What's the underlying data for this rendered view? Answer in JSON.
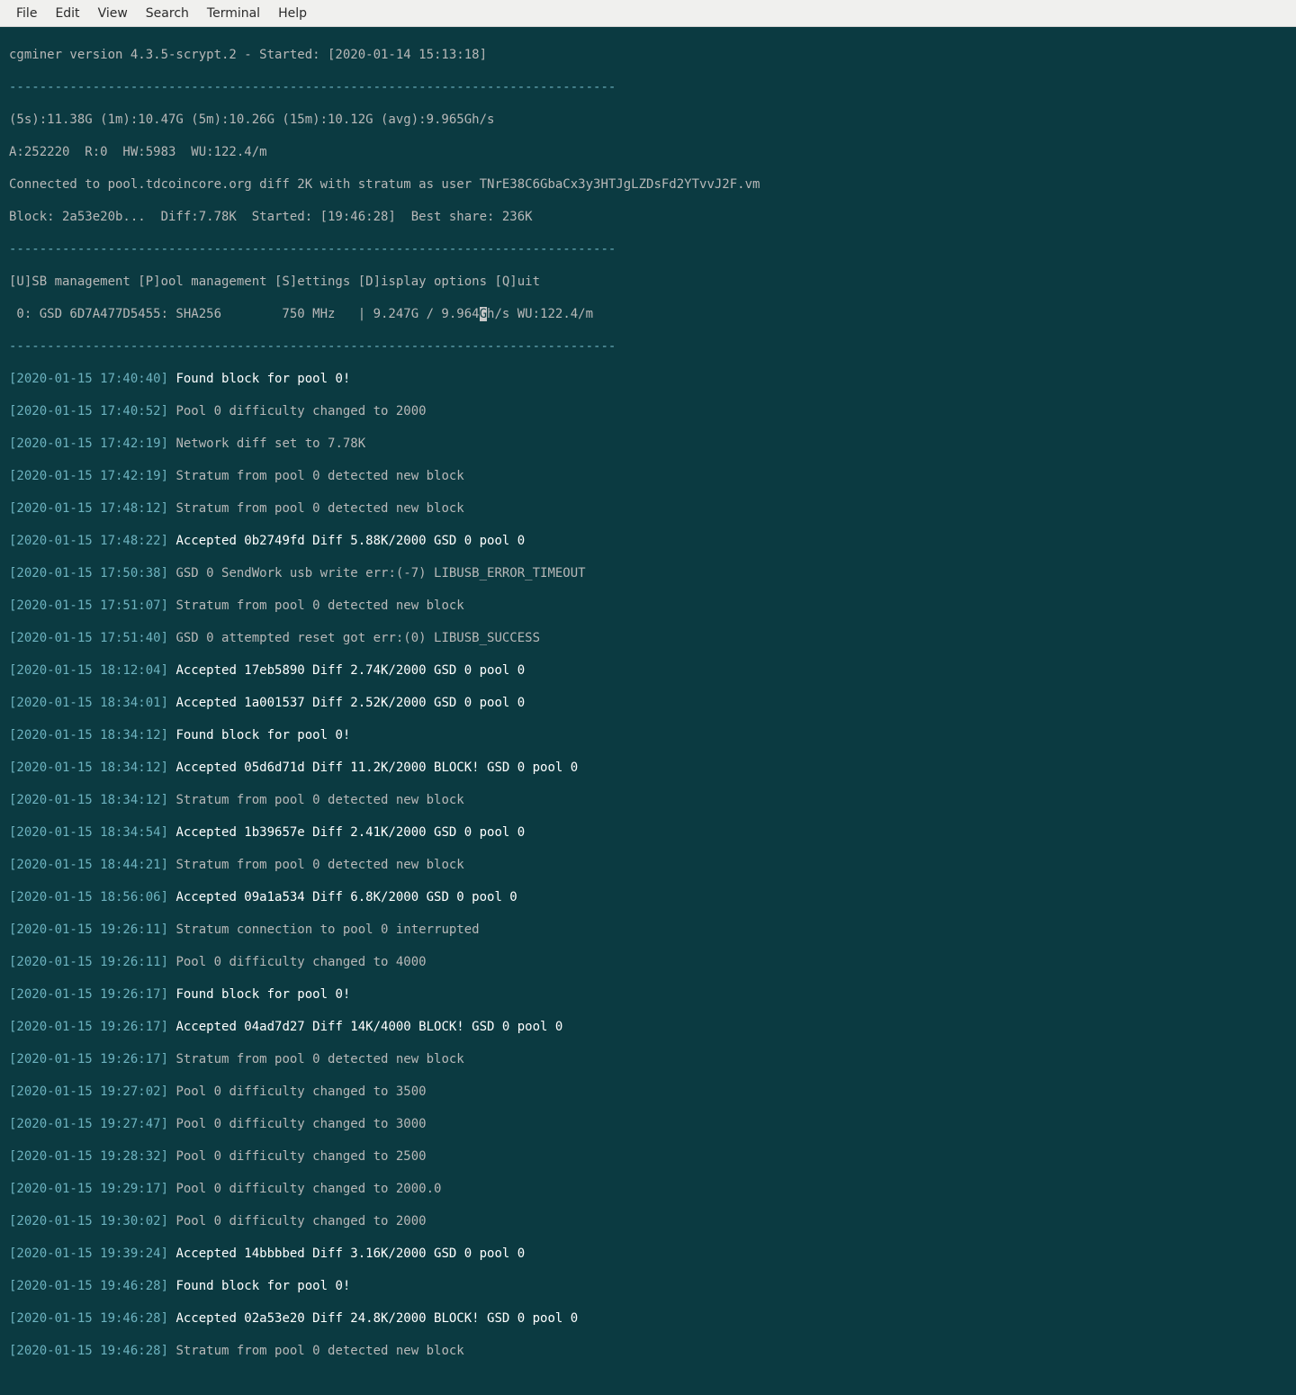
{
  "menu": {
    "items": [
      "File",
      "Edit",
      "View",
      "Search",
      "Terminal",
      "Help"
    ]
  },
  "header": {
    "title": "cgminer version 4.3.5-scrypt.2 - Started: [2020-01-14 15:13:18]"
  },
  "separator": "--------------------------------------------------------------------------------",
  "stats": {
    "hashrate": "(5s):11.38G (1m):10.47G (5m):10.26G (15m):10.12G (avg):9.965Gh/s",
    "shares": "A:252220  R:0  HW:5983  WU:122.4/m",
    "pool": "Connected to pool.tdcoincore.org diff 2K with stratum as user TNrE38C6GbaCx3y3HTJgLZDsFd2YTvvJ2F.vm",
    "block": "Block: 2a53e20b...  Diff:7.78K  Started: [19:46:28]  Best share: 236K"
  },
  "menu_hint": "[U]SB management [P]ool management [S]ettings [D]isplay options [Q]uit",
  "device_line_pre": " 0: GSD 6D7A477D5455: SHA256        750 MHz   | 9.247G / 9.964",
  "device_cursor_char": "G",
  "device_line_post": "h/s WU:122.4/m",
  "log": [
    {
      "ts": "[2020-01-15 17:40:40] ",
      "msg": "Found block for pool 0!",
      "white": true
    },
    {
      "ts": "[2020-01-15 17:40:52] ",
      "msg": "Pool 0 difficulty changed to 2000",
      "white": false
    },
    {
      "ts": "[2020-01-15 17:42:19] ",
      "msg": "Network diff set to 7.78K",
      "white": false
    },
    {
      "ts": "[2020-01-15 17:42:19] ",
      "msg": "Stratum from pool 0 detected new block",
      "white": false
    },
    {
      "ts": "[2020-01-15 17:48:12] ",
      "msg": "Stratum from pool 0 detected new block",
      "white": false
    },
    {
      "ts": "[2020-01-15 17:48:22] ",
      "msg": "Accepted 0b2749fd Diff 5.88K/2000 GSD 0 pool 0",
      "white": true
    },
    {
      "ts": "[2020-01-15 17:50:38] ",
      "msg": "GSD 0 SendWork usb write err:(-7) LIBUSB_ERROR_TIMEOUT",
      "white": false
    },
    {
      "ts": "[2020-01-15 17:51:07] ",
      "msg": "Stratum from pool 0 detected new block",
      "white": false
    },
    {
      "ts": "[2020-01-15 17:51:40] ",
      "msg": "GSD 0 attempted reset got err:(0) LIBUSB_SUCCESS",
      "white": false
    },
    {
      "ts": "[2020-01-15 18:12:04] ",
      "msg": "Accepted 17eb5890 Diff 2.74K/2000 GSD 0 pool 0",
      "white": true
    },
    {
      "ts": "[2020-01-15 18:34:01] ",
      "msg": "Accepted 1a001537 Diff 2.52K/2000 GSD 0 pool 0",
      "white": true
    },
    {
      "ts": "[2020-01-15 18:34:12] ",
      "msg": "Found block for pool 0!",
      "white": true
    },
    {
      "ts": "[2020-01-15 18:34:12] ",
      "msg": "Accepted 05d6d71d Diff 11.2K/2000 BLOCK! GSD 0 pool 0",
      "white": true
    },
    {
      "ts": "[2020-01-15 18:34:12] ",
      "msg": "Stratum from pool 0 detected new block",
      "white": false
    },
    {
      "ts": "[2020-01-15 18:34:54] ",
      "msg": "Accepted 1b39657e Diff 2.41K/2000 GSD 0 pool 0",
      "white": true
    },
    {
      "ts": "[2020-01-15 18:44:21] ",
      "msg": "Stratum from pool 0 detected new block",
      "white": false
    },
    {
      "ts": "[2020-01-15 18:56:06] ",
      "msg": "Accepted 09a1a534 Diff 6.8K/2000 GSD 0 pool 0",
      "white": true
    },
    {
      "ts": "[2020-01-15 19:26:11] ",
      "msg": "Stratum connection to pool 0 interrupted",
      "white": false
    },
    {
      "ts": "[2020-01-15 19:26:11] ",
      "msg": "Pool 0 difficulty changed to 4000",
      "white": false
    },
    {
      "ts": "[2020-01-15 19:26:17] ",
      "msg": "Found block for pool 0!",
      "white": true
    },
    {
      "ts": "[2020-01-15 19:26:17] ",
      "msg": "Accepted 04ad7d27 Diff 14K/4000 BLOCK! GSD 0 pool 0",
      "white": true
    },
    {
      "ts": "[2020-01-15 19:26:17] ",
      "msg": "Stratum from pool 0 detected new block",
      "white": false
    },
    {
      "ts": "[2020-01-15 19:27:02] ",
      "msg": "Pool 0 difficulty changed to 3500",
      "white": false
    },
    {
      "ts": "[2020-01-15 19:27:47] ",
      "msg": "Pool 0 difficulty changed to 3000",
      "white": false
    },
    {
      "ts": "[2020-01-15 19:28:32] ",
      "msg": "Pool 0 difficulty changed to 2500",
      "white": false
    },
    {
      "ts": "[2020-01-15 19:29:17] ",
      "msg": "Pool 0 difficulty changed to 2000.0",
      "white": false
    },
    {
      "ts": "[2020-01-15 19:30:02] ",
      "msg": "Pool 0 difficulty changed to 2000",
      "white": false
    },
    {
      "ts": "[2020-01-15 19:39:24] ",
      "msg": "Accepted 14bbbbed Diff 3.16K/2000 GSD 0 pool 0",
      "white": true
    },
    {
      "ts": "[2020-01-15 19:46:28] ",
      "msg": "Found block for pool 0!",
      "white": true
    },
    {
      "ts": "[2020-01-15 19:46:28] ",
      "msg": "Accepted 02a53e20 Diff 24.8K/2000 BLOCK! GSD 0 pool 0",
      "white": true
    },
    {
      "ts": "[2020-01-15 19:46:28] ",
      "msg": "Stratum from pool 0 detected new block",
      "white": false
    }
  ]
}
